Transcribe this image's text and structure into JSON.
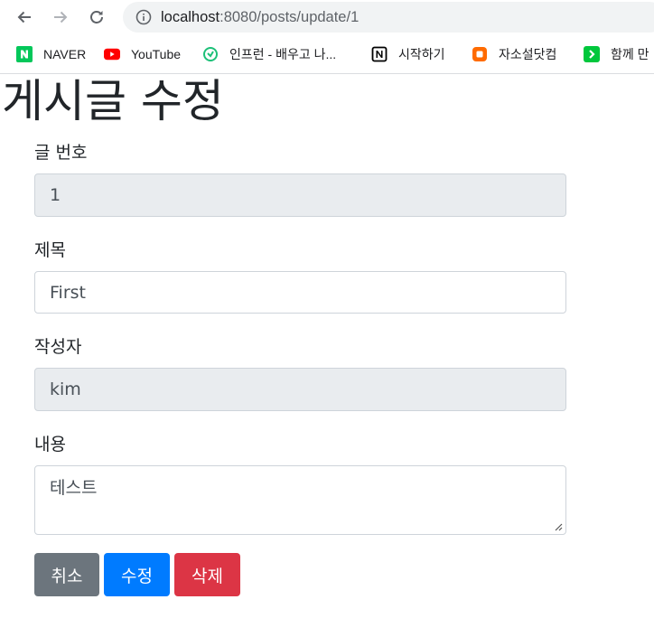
{
  "browser": {
    "url_host": "localhost",
    "url_path": ":8080/posts/update/1",
    "bookmarks": [
      {
        "label": "NAVER",
        "icon": "naver-icon",
        "color": "#03c75a"
      },
      {
        "label": "YouTube",
        "icon": "youtube-icon",
        "color": "#ff0000"
      },
      {
        "label": "인프런 - 배우고 나...",
        "icon": "inflearn-icon",
        "color": "#1dc078"
      },
      {
        "label": "시작하기",
        "icon": "notion-icon",
        "color": "#000000"
      },
      {
        "label": "자소설닷컴",
        "icon": "jasoseol-icon",
        "color": "#ff6b00"
      },
      {
        "label": "함께 만",
        "icon": "green-arrow-icon",
        "color": "#00c73c"
      }
    ]
  },
  "page": {
    "title": "게시글 수정",
    "fields": {
      "id_label": "글 번호",
      "id_value": "1",
      "title_label": "제목",
      "title_value": "First",
      "author_label": "작성자",
      "author_value": "kim",
      "content_label": "내용",
      "content_value": "테스트"
    },
    "buttons": {
      "cancel": "취소",
      "update": "수정",
      "delete": "삭제"
    },
    "colors": {
      "cancel": "#6c757d",
      "update": "#007bff",
      "delete": "#dc3545",
      "readonly_bg": "#e9ecef"
    }
  }
}
